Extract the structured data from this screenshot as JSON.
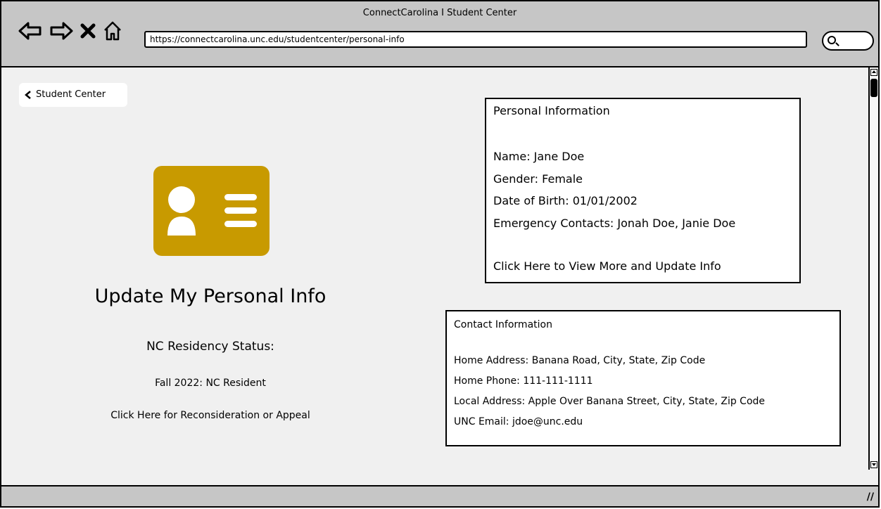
{
  "browser": {
    "title": "ConnectCarolina I Student Center",
    "url": "https://connectcarolina.unc.edu/studentcenter/personal-info"
  },
  "nav": {
    "back_label": "Student Center"
  },
  "profile_card": {
    "icon": "id-card-icon",
    "color": "#c89a00"
  },
  "main": {
    "title": "Update My Personal Info",
    "residency_label": "NC Residency Status:",
    "residency_value": "Fall 2022: NC Resident",
    "appeal_link": "Click Here for Reconsideration or Appeal"
  },
  "personal_info": {
    "heading": "Personal Information",
    "name": "Name: Jane Doe",
    "gender": "Gender: Female",
    "dob": "Date of Birth: 01/01/2002",
    "emergency": "Emergency Contacts: Jonah Doe, Janie Doe",
    "link": "Click Here to View More and Update Info"
  },
  "contact_info": {
    "heading": "Contact Information",
    "home_address": "Home Address: Banana Road, City, State, Zip Code",
    "home_phone": "Home Phone: 111-111-1111",
    "local_address": "Local Address: Apple Over Banana Street, City, State, Zip Code",
    "email": "UNC Email: jdoe@unc.edu"
  }
}
